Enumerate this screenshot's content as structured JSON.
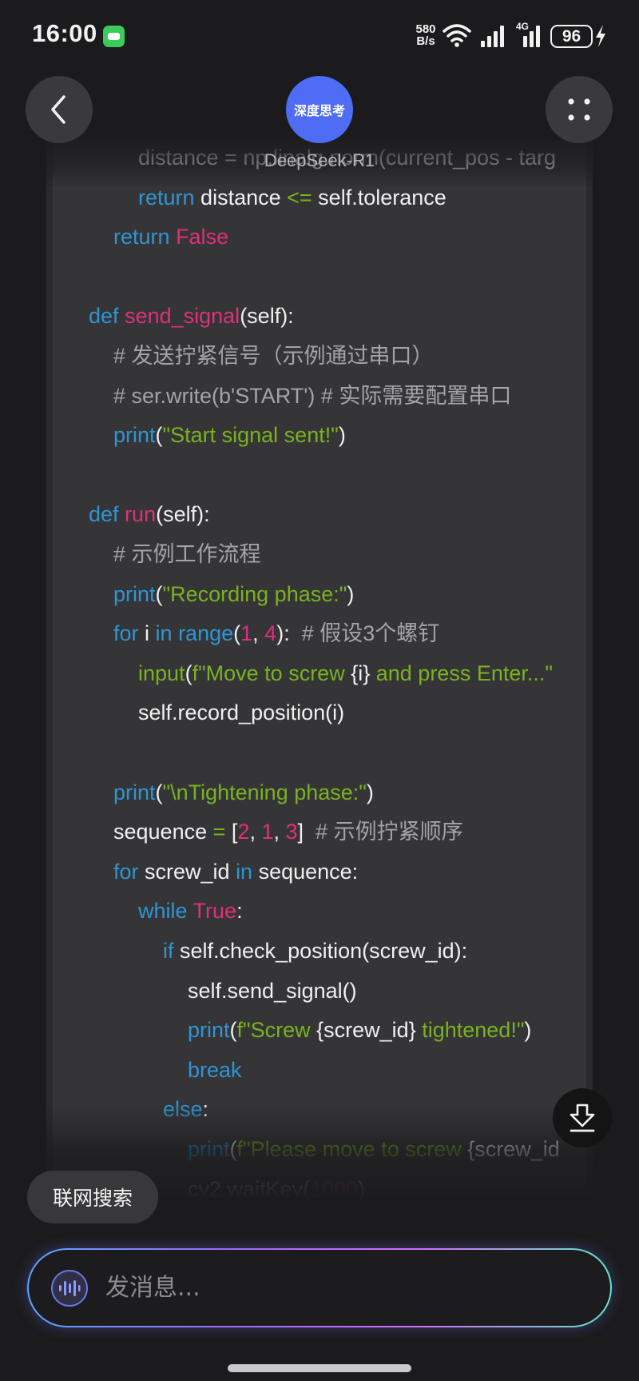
{
  "status_bar": {
    "time": "16:00",
    "net_speed": "580\nB/s",
    "network_label": "4G",
    "battery": "96"
  },
  "header": {
    "badge": "深度思考",
    "model": "DeepSeek-R1"
  },
  "code_lines": [
    {
      "indent": 2,
      "tokens": [
        {
          "t": "distance = np.linalg.norm(current_pos - targ",
          "c": "pl"
        }
      ]
    },
    {
      "indent": 2,
      "tokens": [
        {
          "t": "return",
          "c": "kw"
        },
        {
          "t": " distance ",
          "c": "pl"
        },
        {
          "t": "<=",
          "c": "str"
        },
        {
          "t": " self.tolerance",
          "c": "pl"
        }
      ]
    },
    {
      "indent": 1,
      "tokens": [
        {
          "t": "return",
          "c": "kw"
        },
        {
          "t": " ",
          "c": "pl"
        },
        {
          "t": "False",
          "c": "fn"
        }
      ]
    },
    {
      "indent": 0,
      "tokens": []
    },
    {
      "indent": 0,
      "tokens": [
        {
          "t": "def",
          "c": "kw"
        },
        {
          "t": " ",
          "c": "pl"
        },
        {
          "t": "send_signal",
          "c": "fn"
        },
        {
          "t": "(self):",
          "c": "pl"
        }
      ]
    },
    {
      "indent": 1,
      "tokens": [
        {
          "t": "# 发送拧紧信号（示例通过串口）",
          "c": "cm"
        }
      ]
    },
    {
      "indent": 1,
      "tokens": [
        {
          "t": "# ser.write(b'START') # 实际需要配置串口",
          "c": "cm"
        }
      ]
    },
    {
      "indent": 1,
      "tokens": [
        {
          "t": "print",
          "c": "kw"
        },
        {
          "t": "(",
          "c": "pl"
        },
        {
          "t": "\"Start signal sent!\"",
          "c": "str"
        },
        {
          "t": ")",
          "c": "pl"
        }
      ]
    },
    {
      "indent": 0,
      "tokens": []
    },
    {
      "indent": 0,
      "tokens": [
        {
          "t": "def",
          "c": "kw"
        },
        {
          "t": " ",
          "c": "pl"
        },
        {
          "t": "run",
          "c": "fn"
        },
        {
          "t": "(self):",
          "c": "pl"
        }
      ]
    },
    {
      "indent": 1,
      "tokens": [
        {
          "t": "# 示例工作流程",
          "c": "cm"
        }
      ]
    },
    {
      "indent": 1,
      "tokens": [
        {
          "t": "print",
          "c": "kw"
        },
        {
          "t": "(",
          "c": "pl"
        },
        {
          "t": "\"Recording phase:\"",
          "c": "str"
        },
        {
          "t": ")",
          "c": "pl"
        }
      ]
    },
    {
      "indent": 1,
      "tokens": [
        {
          "t": "for",
          "c": "kw"
        },
        {
          "t": " i ",
          "c": "pl"
        },
        {
          "t": "in",
          "c": "kw"
        },
        {
          "t": " ",
          "c": "pl"
        },
        {
          "t": "range",
          "c": "kw"
        },
        {
          "t": "(",
          "c": "pl"
        },
        {
          "t": "1",
          "c": "num"
        },
        {
          "t": ", ",
          "c": "pl"
        },
        {
          "t": "4",
          "c": "num"
        },
        {
          "t": "):  ",
          "c": "pl"
        },
        {
          "t": "# 假设3个螺钉",
          "c": "cm"
        }
      ]
    },
    {
      "indent": 2,
      "tokens": [
        {
          "t": "input",
          "c": "str"
        },
        {
          "t": "(",
          "c": "pl"
        },
        {
          "t": "f\"Move to screw ",
          "c": "str"
        },
        {
          "t": "{i}",
          "c": "pl"
        },
        {
          "t": " and press Enter...\"",
          "c": "str"
        }
      ]
    },
    {
      "indent": 2,
      "tokens": [
        {
          "t": "self.record_position(i)",
          "c": "pl"
        }
      ]
    },
    {
      "indent": 0,
      "tokens": []
    },
    {
      "indent": 1,
      "tokens": [
        {
          "t": "print",
          "c": "kw"
        },
        {
          "t": "(",
          "c": "pl"
        },
        {
          "t": "\"\\nTightening phase:\"",
          "c": "str"
        },
        {
          "t": ")",
          "c": "pl"
        }
      ]
    },
    {
      "indent": 1,
      "tokens": [
        {
          "t": "sequence ",
          "c": "pl"
        },
        {
          "t": "=",
          "c": "str"
        },
        {
          "t": " [",
          "c": "pl"
        },
        {
          "t": "2",
          "c": "num"
        },
        {
          "t": ", ",
          "c": "pl"
        },
        {
          "t": "1",
          "c": "num"
        },
        {
          "t": ", ",
          "c": "pl"
        },
        {
          "t": "3",
          "c": "num"
        },
        {
          "t": "]  ",
          "c": "pl"
        },
        {
          "t": "# 示例拧紧顺序",
          "c": "cm"
        }
      ]
    },
    {
      "indent": 1,
      "tokens": [
        {
          "t": "for",
          "c": "kw"
        },
        {
          "t": " screw_id ",
          "c": "pl"
        },
        {
          "t": "in",
          "c": "kw"
        },
        {
          "t": " sequence:",
          "c": "pl"
        }
      ]
    },
    {
      "indent": 2,
      "tokens": [
        {
          "t": "while",
          "c": "kw"
        },
        {
          "t": " ",
          "c": "pl"
        },
        {
          "t": "True",
          "c": "fn"
        },
        {
          "t": ":",
          "c": "pl"
        }
      ]
    },
    {
      "indent": 3,
      "tokens": [
        {
          "t": "if",
          "c": "kw"
        },
        {
          "t": " self.check_position(screw_id):",
          "c": "pl"
        }
      ]
    },
    {
      "indent": 4,
      "tokens": [
        {
          "t": "self.send_signal()",
          "c": "pl"
        }
      ]
    },
    {
      "indent": 4,
      "tokens": [
        {
          "t": "print",
          "c": "kw"
        },
        {
          "t": "(",
          "c": "pl"
        },
        {
          "t": "f\"Screw ",
          "c": "str"
        },
        {
          "t": "{screw_id}",
          "c": "pl"
        },
        {
          "t": " tightened!\"",
          "c": "str"
        },
        {
          "t": ")",
          "c": "pl"
        }
      ]
    },
    {
      "indent": 4,
      "tokens": [
        {
          "t": "break",
          "c": "kw"
        }
      ]
    },
    {
      "indent": 3,
      "tokens": [
        {
          "t": "else",
          "c": "kw"
        },
        {
          "t": ":",
          "c": "pl"
        }
      ]
    },
    {
      "indent": 4,
      "tokens": [
        {
          "t": "print",
          "c": "kw"
        },
        {
          "t": "(",
          "c": "pl"
        },
        {
          "t": "f\"Please move to screw ",
          "c": "str"
        },
        {
          "t": "{screw_id",
          "c": "pl"
        }
      ]
    },
    {
      "indent": 4,
      "tokens": [
        {
          "t": "cv2.waitKey(",
          "c": "pl"
        },
        {
          "t": "1000",
          "c": "num"
        },
        {
          "t": ")",
          "c": "pl"
        }
      ]
    }
  ],
  "web_search": "联网搜索",
  "input": {
    "placeholder": "发消息..."
  }
}
